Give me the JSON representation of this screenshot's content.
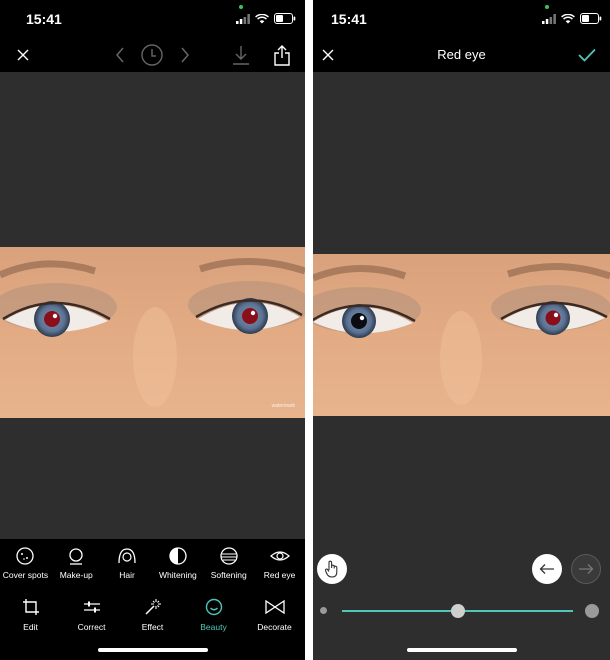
{
  "left_screen": {
    "status": {
      "time": "15:41"
    },
    "toolbar": {
      "icons": [
        "close-icon",
        "undo-arrow-icon",
        "history-icon",
        "redo-arrow-icon",
        "download-icon",
        "share-icon"
      ]
    },
    "photo": {
      "watermark": "watermark"
    },
    "beauty_tools": [
      {
        "label": "Cover spots",
        "icon": "cover-spots-icon"
      },
      {
        "label": "Make-up",
        "icon": "makeup-icon"
      },
      {
        "label": "Hair",
        "icon": "hair-icon"
      },
      {
        "label": "Whitening",
        "icon": "whitening-icon"
      },
      {
        "label": "Softening",
        "icon": "softening-icon"
      },
      {
        "label": "Red eye",
        "icon": "red-eye-icon"
      }
    ],
    "tabs": [
      {
        "label": "Edit",
        "icon": "crop-icon",
        "active": false
      },
      {
        "label": "Correct",
        "icon": "sliders-icon",
        "active": false
      },
      {
        "label": "Effect",
        "icon": "magic-wand-icon",
        "active": false
      },
      {
        "label": "Beauty",
        "icon": "smiley-icon",
        "active": true
      },
      {
        "label": "Decorate",
        "icon": "bowtie-icon",
        "active": false
      }
    ],
    "colors": {
      "accent": "#4fc6b9"
    }
  },
  "right_screen": {
    "status": {
      "time": "15:41"
    },
    "toolbar": {
      "title": "Red eye",
      "icons": [
        "close-icon",
        "checkmark-icon"
      ]
    },
    "controls": {
      "icons": [
        "hand-icon",
        "undo-left-arrow-icon",
        "redo-right-arrow-icon"
      ],
      "brush_size_level": 0.5
    },
    "colors": {
      "accent": "#4fc6b9"
    }
  }
}
